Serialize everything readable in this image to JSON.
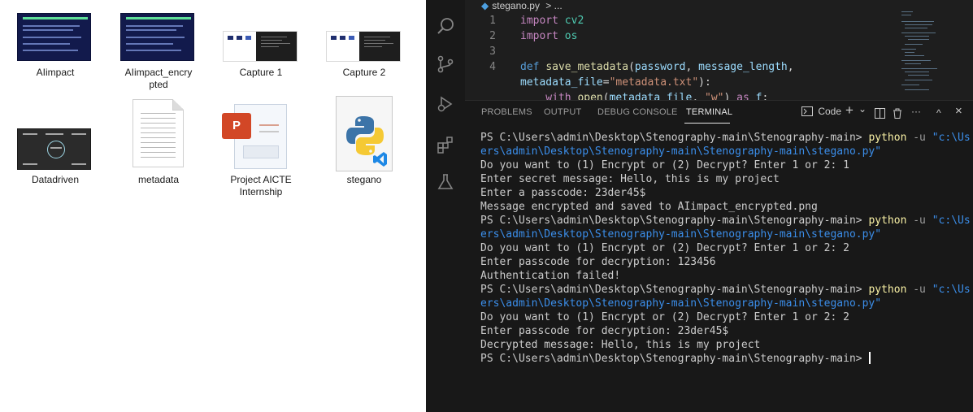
{
  "explorer": {
    "files": [
      {
        "label": "AIimpact",
        "kind": "slide-image"
      },
      {
        "label": "AIimpact_encrypted",
        "kind": "slide-image"
      },
      {
        "label": "Capture 1",
        "kind": "screenshot-image"
      },
      {
        "label": "Capture 2",
        "kind": "screenshot-image"
      },
      {
        "label": "Datadriven",
        "kind": "diagram-image"
      },
      {
        "label": "metadata",
        "kind": "text-file"
      },
      {
        "label": "Project AICTE Internship",
        "kind": "powerpoint-file"
      },
      {
        "label": "stegano",
        "kind": "python-file"
      }
    ]
  },
  "vscode": {
    "breadcrumb": {
      "file": "stegano.py",
      "separator": ">",
      "more": "..."
    },
    "code": [
      {
        "num": "1",
        "tokens": [
          {
            "t": "import",
            "c": "kw"
          },
          {
            "t": " ",
            "c": "pun"
          },
          {
            "t": "cv2",
            "c": "mod"
          }
        ]
      },
      {
        "num": "2",
        "tokens": [
          {
            "t": "import",
            "c": "kw"
          },
          {
            "t": " ",
            "c": "pun"
          },
          {
            "t": "os",
            "c": "mod"
          }
        ]
      },
      {
        "num": "3",
        "tokens": []
      },
      {
        "num": "4",
        "tokens": [
          {
            "t": "def",
            "c": "kw2"
          },
          {
            "t": " ",
            "c": "pun"
          },
          {
            "t": "save_metadata",
            "c": "fn"
          },
          {
            "t": "(",
            "c": "pun"
          },
          {
            "t": "password",
            "c": "prm"
          },
          {
            "t": ", ",
            "c": "pun"
          },
          {
            "t": "message_length",
            "c": "prm"
          },
          {
            "t": ",",
            "c": "pun"
          }
        ]
      },
      {
        "num": "",
        "tokens": [
          {
            "t": "metadata_file",
            "c": "prm"
          },
          {
            "t": "=",
            "c": "pun"
          },
          {
            "t": "\"metadata.txt\"",
            "c": "str"
          },
          {
            "t": "):",
            "c": "pun"
          }
        ]
      },
      {
        "num": "",
        "tokens": [
          {
            "t": "    with ",
            "c": "kw"
          },
          {
            "t": "open",
            "c": "fn"
          },
          {
            "t": "(",
            "c": "pun"
          },
          {
            "t": "metadata_file",
            "c": "prm"
          },
          {
            "t": ", ",
            "c": "pun"
          },
          {
            "t": "\"w\"",
            "c": "str"
          },
          {
            "t": ") ",
            "c": "pun"
          },
          {
            "t": "as",
            "c": "kw"
          },
          {
            "t": " ",
            "c": "pun"
          },
          {
            "t": "f",
            "c": "prm"
          },
          {
            "t": ":",
            "c": "pun"
          }
        ]
      }
    ],
    "panel": {
      "tabs": [
        "PROBLEMS",
        "OUTPUT",
        "DEBUG CONSOLE",
        "TERMINAL"
      ],
      "active_tab": "TERMINAL",
      "shell_label": "Code",
      "controls": {
        "add": "+",
        "add_menu": "⌄",
        "split": "split-icon",
        "trash": "trash-icon",
        "more": "···",
        "maximize": "^",
        "close": "×"
      }
    },
    "terminal": [
      [
        {
          "t": "PS C:\\Users\\admin\\Desktop\\Stenography-main\\Stenography-main> ",
          "c": "plain"
        },
        {
          "t": "python",
          "c": "cmd"
        },
        {
          "t": " -u ",
          "c": "flag"
        },
        {
          "t": "\"c:\\Us",
          "c": "path"
        }
      ],
      [
        {
          "t": "ers\\admin\\Desktop\\Stenography-main\\Stenography-main\\stegano.py\"",
          "c": "path"
        }
      ],
      [
        {
          "t": "Do you want to (1) Encrypt or (2) Decrypt? Enter 1 or 2: 1",
          "c": "plain"
        }
      ],
      [
        {
          "t": "Enter secret message: Hello, this is my project",
          "c": "plain"
        }
      ],
      [
        {
          "t": "Enter a passcode: 23der45$",
          "c": "plain"
        }
      ],
      [
        {
          "t": "Message encrypted and saved to AIimpact_encrypted.png",
          "c": "plain"
        }
      ],
      [
        {
          "t": "PS C:\\Users\\admin\\Desktop\\Stenography-main\\Stenography-main> ",
          "c": "plain"
        },
        {
          "t": "python",
          "c": "cmd"
        },
        {
          "t": " -u ",
          "c": "flag"
        },
        {
          "t": "\"c:\\Us",
          "c": "path"
        }
      ],
      [
        {
          "t": "ers\\admin\\Desktop\\Stenography-main\\Stenography-main\\stegano.py\"",
          "c": "path"
        }
      ],
      [
        {
          "t": "Do you want to (1) Encrypt or (2) Decrypt? Enter 1 or 2: 2",
          "c": "plain"
        }
      ],
      [
        {
          "t": "Enter passcode for decryption: 123456",
          "c": "plain"
        }
      ],
      [
        {
          "t": "Authentication failed!",
          "c": "plain"
        }
      ],
      [
        {
          "t": "PS C:\\Users\\admin\\Desktop\\Stenography-main\\Stenography-main> ",
          "c": "plain"
        },
        {
          "t": "python",
          "c": "cmd"
        },
        {
          "t": " -u ",
          "c": "flag"
        },
        {
          "t": "\"c:\\Us",
          "c": "path"
        }
      ],
      [
        {
          "t": "ers\\admin\\Desktop\\Stenography-main\\Stenography-main\\stegano.py\"",
          "c": "path"
        }
      ],
      [
        {
          "t": "Do you want to (1) Encrypt or (2) Decrypt? Enter 1 or 2: 2",
          "c": "plain"
        }
      ],
      [
        {
          "t": "Enter passcode for decryption: 23der45$",
          "c": "plain"
        }
      ],
      [
        {
          "t": "Decrypted message: Hello, this is my project",
          "c": "plain"
        }
      ],
      [
        {
          "t": "PS C:\\Users\\admin\\Desktop\\Stenography-main\\Stenography-main> ",
          "c": "plain"
        }
      ]
    ]
  }
}
